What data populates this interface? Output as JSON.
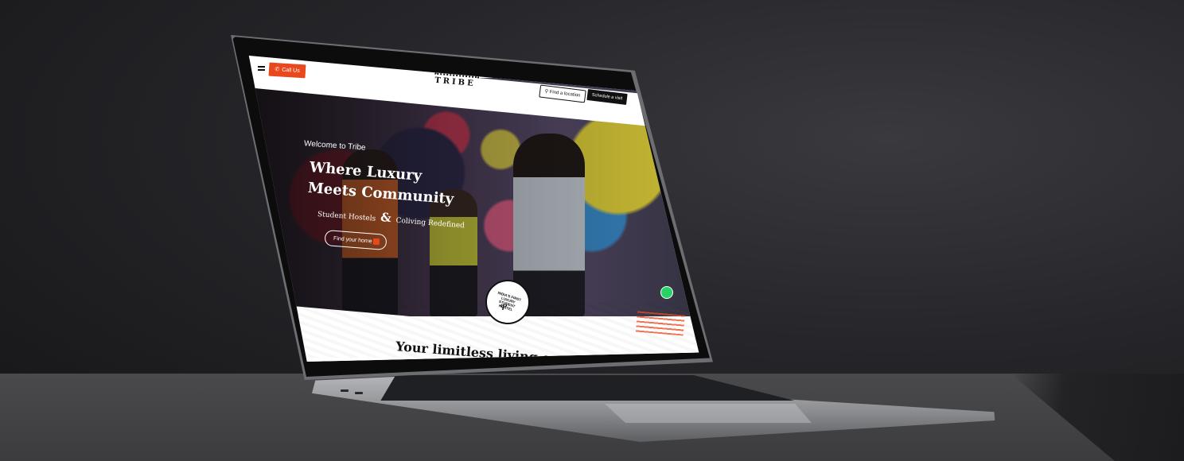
{
  "header": {
    "call_label": "Call Us",
    "logo_text": "TRIBE",
    "find_location_label": "Find a location",
    "schedule_label": "Schedule a visit"
  },
  "hero": {
    "welcome": "Welcome to Tribe",
    "headline_line1": "Where Luxury",
    "headline_line2": "Meets Community",
    "sub_left": "Student Hostels",
    "sub_amp": "&",
    "sub_right": "Coliving Redefined",
    "cta_label": "Find your home"
  },
  "badge": {
    "ring_text": "INDIA'S FIRST LUXURY STUDENT HOSTEL"
  },
  "section": {
    "title": "Your limitless living experience"
  },
  "colors": {
    "accent": "#e9481f",
    "whatsapp": "#25d366"
  },
  "icons": {
    "menu": "menu-icon",
    "phone": "phone-icon",
    "location": "location-pin-icon",
    "arrow": "arrow-right-icon",
    "whatsapp": "whatsapp-icon"
  }
}
